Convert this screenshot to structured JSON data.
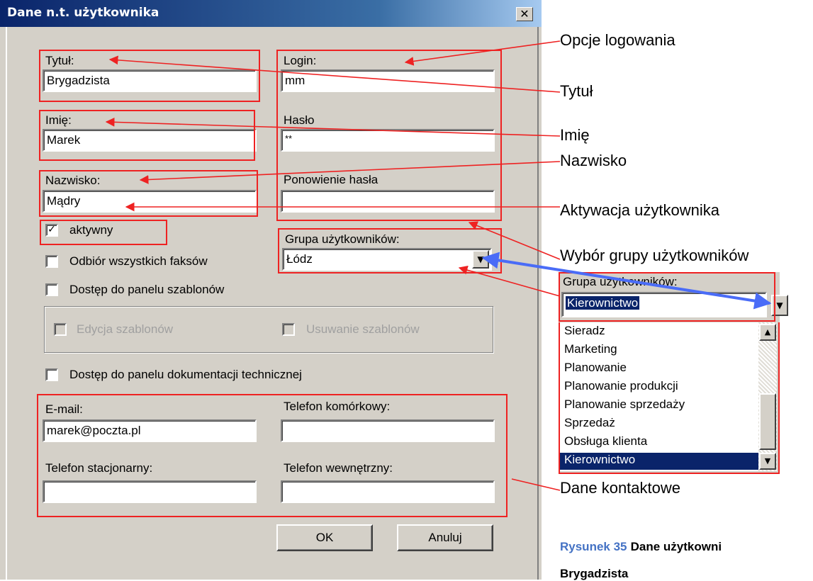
{
  "window": {
    "title": "Dane n.t. użytkownika",
    "close_label": "✕"
  },
  "form": {
    "title_label": "Tytuł:",
    "title_value": "Brygadzista",
    "first_name_label": "Imię:",
    "first_name_value": "Marek",
    "last_name_label": "Nazwisko:",
    "last_name_value": "Mądry",
    "login_label": "Login:",
    "login_value": "mm",
    "password_label": "Hasło",
    "password_value": "**",
    "password_repeat_label": "Ponowienie hasła",
    "password_repeat_value": "",
    "group_label": "Grupa użytkowników:",
    "group_value": "Łódz",
    "active_label": "aktywny",
    "active_checked": "✓",
    "fax_label": "Odbiór wszystkich faksów",
    "templates_panel_label": "Dostęp do panelu szablonów",
    "edit_templates_label": "Edycja szablonów",
    "delete_templates_label": "Usuwanie szablonów",
    "tech_docs_label": "Dostęp do panelu dokumentacji technicznej",
    "email_label": "E-mail:",
    "email_value": "marek@poczta.pl",
    "mobile_label": "Telefon komórkowy:",
    "mobile_value": "",
    "landline_label": "Telefon stacjonarny:",
    "landline_value": "",
    "internal_label": "Telefon wewnętrzny:",
    "internal_value": "",
    "ok_label": "OK",
    "cancel_label": "Anuluj"
  },
  "annotations": {
    "login_options": "Opcje logowania",
    "title": "Tytuł",
    "first_name": "Imię",
    "last_name": "Nazwisko",
    "activation": "Aktywacja użytkownika",
    "group_choice": "Wybór grupy użytkowników",
    "contact": "Dane kontaktowe"
  },
  "dropdown_panel": {
    "label": "Grupa użytkowników:",
    "selected": "Kierownictwo",
    "options": [
      "Sieradz",
      "Marketing",
      "Planowanie",
      "Planowanie produkcji",
      "Planowanie sprzedaży",
      "Sprzedaż",
      "Obsługa klienta",
      "Kierownictwo"
    ],
    "highlighted_option": "Kierownictwo"
  },
  "caption": {
    "prefix": "Rysunek 35",
    "text": "Dane użytkowni",
    "line2": "Brygadzista"
  },
  "colors": {
    "title_bar": "#0a246a",
    "annotation_box": "#ee2222",
    "blue_arrow": "#4a6cf7",
    "selection": "#0a246a",
    "dialog_bg": "#d4d0c8"
  },
  "icons": {
    "close": "close-icon",
    "dropdown": "chevron-down-icon",
    "scroll_up": "scroll-up-icon",
    "scroll_down": "scroll-down-icon"
  }
}
